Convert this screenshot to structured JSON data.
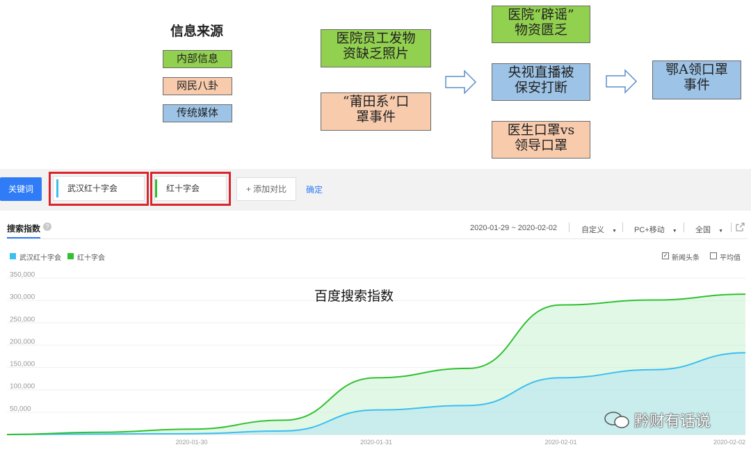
{
  "diagram": {
    "source_title": "信息来源",
    "legend": [
      "内部信息",
      "网民八卦",
      "传统媒体"
    ],
    "boxes": {
      "staff_photos": "医院员工发物资缺乏照片",
      "putian_masks": "“莆田系”口罩事件",
      "rumor_refute": "医院“辟谣”物资匮乏",
      "cctv_interrupted": "央视直播被保安打断",
      "doctor_vs_leader": "医生口罩vs领导口罩",
      "ea_mask": "鄂A领口罩事件"
    },
    "box_lines": {
      "staff_photos": [
        "医院员工发物",
        "资缺乏照片"
      ],
      "putian_masks": [
        "“莆田系”口",
        "罩事件"
      ],
      "rumor_refute": [
        "医院“辟谣”",
        "物资匮乏"
      ],
      "cctv_interrupted": [
        "央视直播被",
        "保安打断"
      ],
      "doctor_vs_leader": [
        "医生口罩vs",
        "领导口罩"
      ],
      "ea_mask": [
        "鄂A领口罩",
        "事件"
      ]
    }
  },
  "keyword_bar": {
    "label": "关键词",
    "keywords": [
      "武汉红十字会",
      "红十字会"
    ],
    "add_compare": "+ 添加对比",
    "confirm": "确定"
  },
  "index_header": {
    "title": "搜索指数",
    "date_range": "2020-01-29 ~ 2020-02-02",
    "custom": "自定义",
    "device": "PC+移动",
    "region": "全国",
    "news_headlines": "新闻头条",
    "average": "平均值",
    "news_checked": true,
    "average_checked": false
  },
  "watermark": "黔财有话说",
  "chart_data": {
    "type": "area",
    "title": "百度搜索指数",
    "xlabel": "",
    "ylabel": "",
    "x": [
      "2020-01-29",
      "2020-01-29 12:00",
      "2020-01-30",
      "2020-01-30 12:00",
      "2020-01-31",
      "2020-01-31 12:00",
      "2020-02-01",
      "2020-02-01 12:00",
      "2020-02-02"
    ],
    "x_ticks": [
      "2020-01-30",
      "2020-01-31",
      "2020-02-01",
      "2020-02-02"
    ],
    "y_ticks": [
      "350,000",
      "300,000",
      "250,000",
      "200,000",
      "150,000",
      "100,000",
      "50,000"
    ],
    "ylim": [
      0,
      350000
    ],
    "grid": true,
    "legend_position": "top-left",
    "series": [
      {
        "name": "武汉红十字会",
        "color": "#3cbef0",
        "values": [
          0,
          1000,
          2000,
          8000,
          55000,
          65000,
          127000,
          145000,
          183000
        ]
      },
      {
        "name": "红十字会",
        "color": "#30c030",
        "values": [
          0,
          5000,
          12000,
          32000,
          127000,
          148000,
          290000,
          301000,
          314000
        ]
      }
    ]
  }
}
